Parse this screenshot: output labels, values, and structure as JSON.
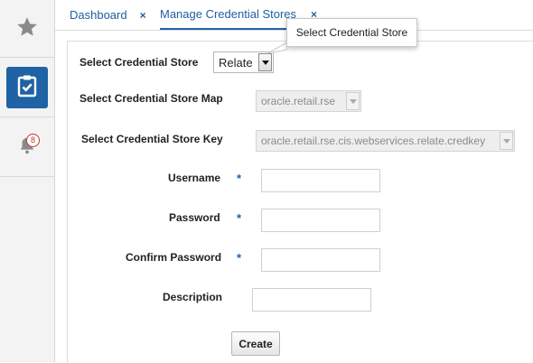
{
  "rail": {
    "items": [
      {
        "icon": "star-icon"
      },
      {
        "icon": "tasks-checklist-icon",
        "active": true
      },
      {
        "icon": "bell-icon",
        "badge": "8"
      }
    ]
  },
  "tabs": [
    {
      "label": "Dashboard"
    },
    {
      "label": "Manage Credential Stores",
      "active": true
    }
  ],
  "tab_close_glyph": "×",
  "tooltip": {
    "text": "Select Credential Store"
  },
  "form": {
    "store": {
      "label": "Select Credential Store",
      "value": "Relate"
    },
    "store_map": {
      "label": "Select Credential Store Map",
      "value": "oracle.retail.rse"
    },
    "store_key": {
      "label": "Select Credential Store Key",
      "value": "oracle.retail.rse.cis.webservices.relate.credkey"
    },
    "username": {
      "label": "Username",
      "required": "*",
      "value": ""
    },
    "password": {
      "label": "Password",
      "required": "*",
      "value": ""
    },
    "confirm_password": {
      "label": "Confirm Password",
      "required": "*",
      "value": ""
    },
    "description": {
      "label": "Description",
      "value": ""
    },
    "create_label": "Create"
  },
  "colors": {
    "accent": "#1f63a5",
    "link": "#1f5f9d",
    "badge": "#c0392b"
  }
}
